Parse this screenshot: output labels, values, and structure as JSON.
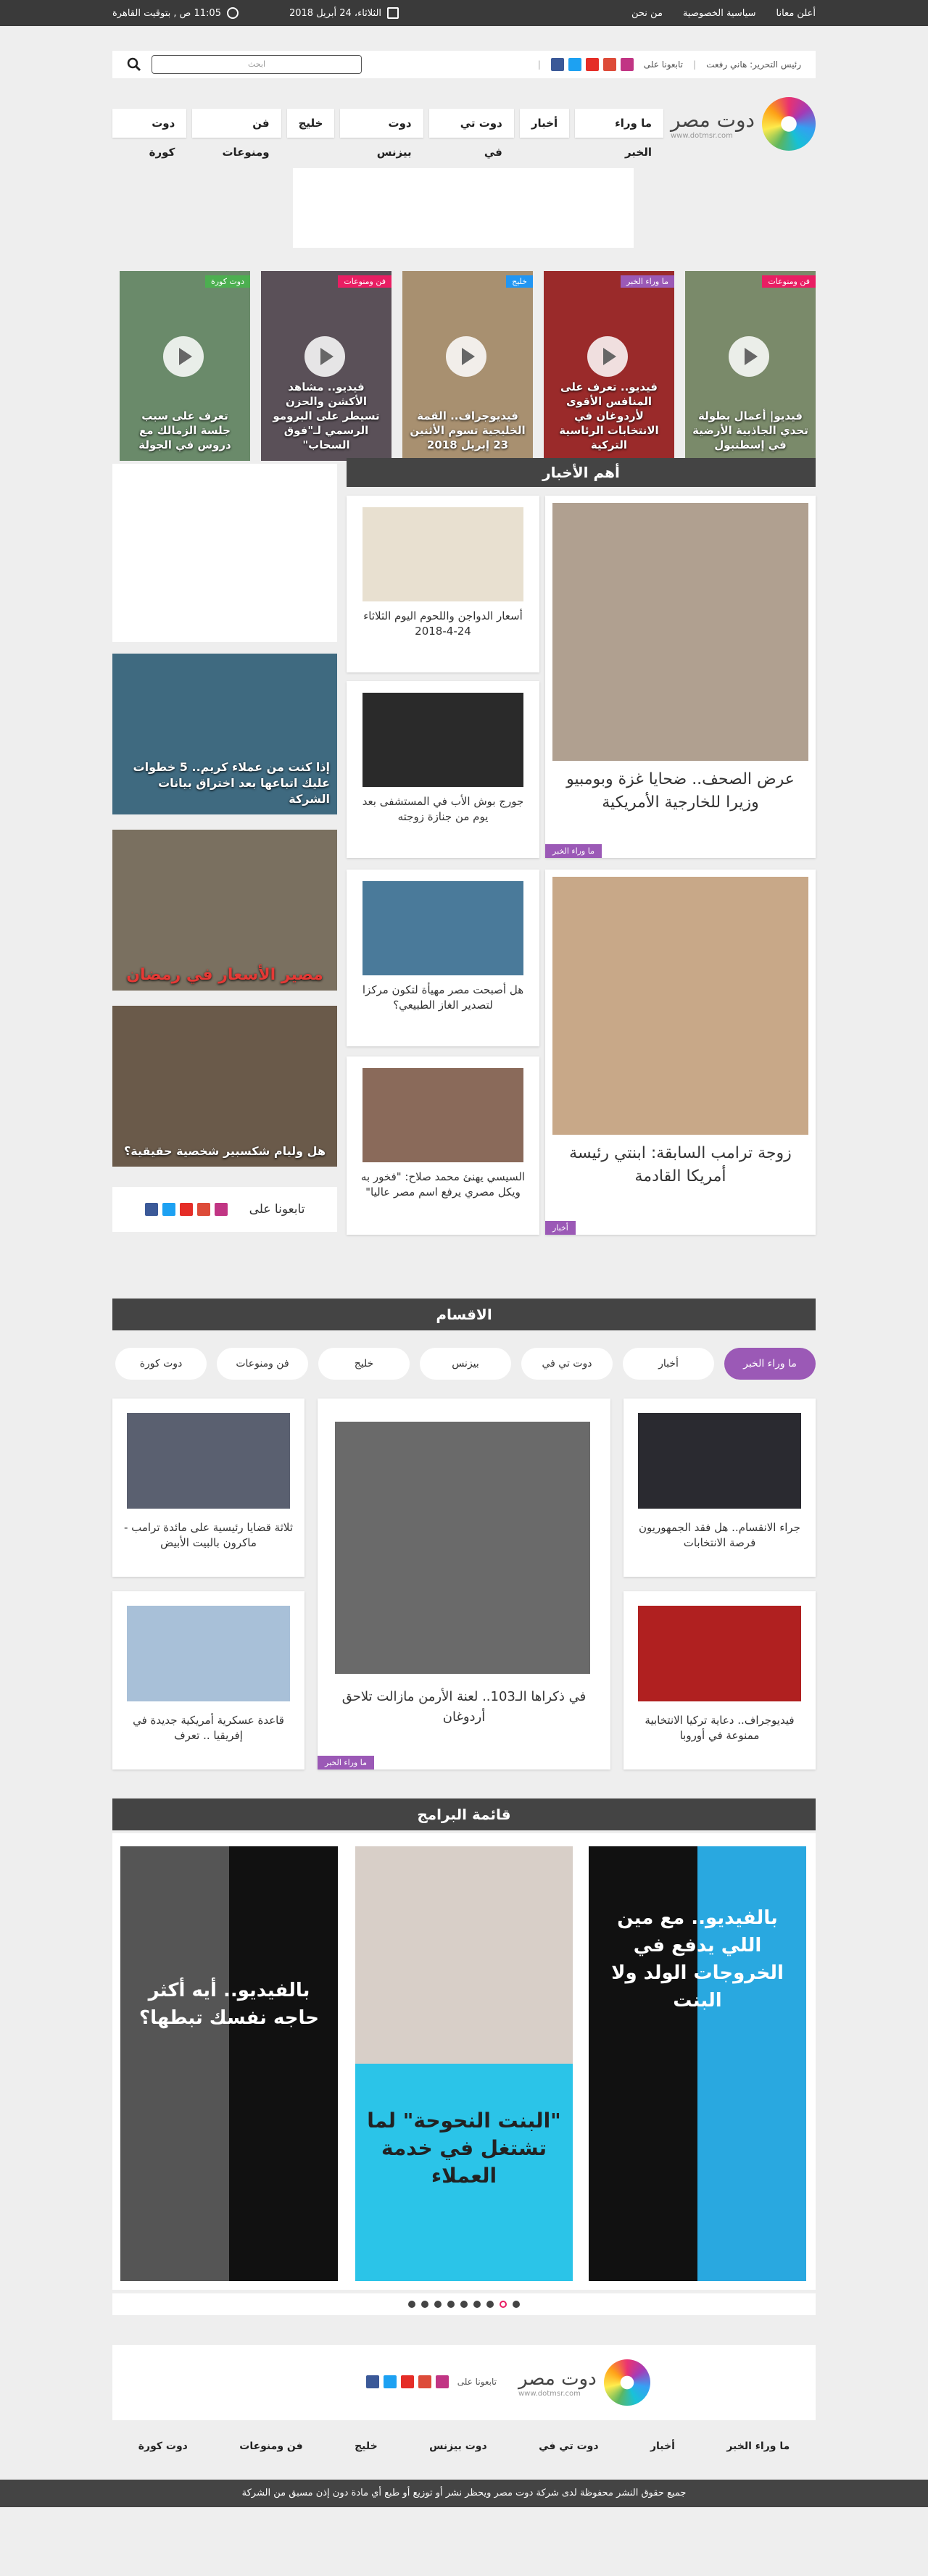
{
  "topbar": {
    "links": [
      "أعلن معانا",
      "سياسية الخصوصية",
      "من نحن"
    ],
    "date": "الثلاثاء، 24 أبريل 2018",
    "time": "11:05 ص , بتوقيت القاهرة"
  },
  "sitebar": {
    "editor": "رئيس التحرير: هاني رفعت",
    "follow": "تابعونا على",
    "search_placeholder": "ابحث"
  },
  "logo": {
    "title": "دوت مصر",
    "subtitle": "www.dotmsr.com"
  },
  "nav": [
    "ما وراء الخبر",
    "أخبار",
    "دوت تي في",
    "دوت بيزنس",
    "خليج",
    "فن ومنوعات",
    "دوت كورة"
  ],
  "videos": [
    {
      "cat": "فن ومنوعات",
      "title": "فيديو| أعمال بطولة تحدي الجاذبية الأرضية في إسطنبول"
    },
    {
      "cat": "ما وراء الخبر",
      "title": "فيديو.. تعرف على المنافس الأقوى لأردوغان في الانتخابات الرئاسية التركية"
    },
    {
      "cat": "خليج",
      "title": "فيديوجراف.. القمة الخليجية تسوم الأثنين 23 إبريل 2018"
    },
    {
      "cat": "فن ومنوعات",
      "title": "فيديو.. مشاهد الأكشن والحزن تسيطر على البرومو الرسمي لـ\"فوق السحاب\""
    },
    {
      "cat": "دوت كورة",
      "title": "تعرف على سبب جلسة الزمالك مع دروس في الجولة"
    }
  ],
  "top_news": {
    "heading": "أهم الأخبار",
    "main": [
      {
        "title": "عرض الصحف.. ضحايا غزة وبومبيو وزيرا للخارجية الأمريكية",
        "tag": "ما وراء الخبر"
      },
      {
        "title": "زوجة ترامب السابقة: ابنتي رئيسة أمريكا القادمة",
        "tag": "أخبار"
      }
    ],
    "small": [
      "أسعار الدواجن واللحوم اليوم الثلاثاء 24-4-2018",
      "جورج بوش الأب في المستشفى بعد يوم من جنازة زوجته",
      "هل أصبحت مصر مهيأة لتكون مركزا لتصدير الغاز الطبيعي؟",
      "السيسي يهنئ محمد صلاح: \"فخور به ويكل مصري يرفع اسم مصر عاليا\""
    ]
  },
  "side": {
    "items": [
      "إذا كنت من عملاء كريم.. 5 خطوات عليك اتباعها بعد اختراق بيانات الشركة",
      "مصير الأسعار في رمضان",
      "هل وليام شكسبير شخصية حقيقية؟"
    ],
    "follow": "تابعونا على"
  },
  "sections": {
    "heading": "الاقسام",
    "tabs": [
      "ما وراء الخبر",
      "أخبار",
      "دوت تي في",
      "بيزنس",
      "خليج",
      "فن ومنوعات",
      "دوت كورة"
    ],
    "cards": [
      "جراء الانقسام.. هل فقد الجمهوريون فرصة الانتخابات",
      "في ذكراها الـ103.. لعنة الأرمن مازالت تلاحق أردوغان",
      "ثلاثة قضايا رئيسية على مائدة ترامب - ماكرون بالبيت الأبيض",
      "فيديوجراف.. دعاية تركيا الانتخابية ممنوعة في أوروبا",
      "قاعدة عسكرية أمريكية جديدة في إفريقيا .. تعرف"
    ],
    "tag": "ما وراء الخبر"
  },
  "programs": {
    "heading": "قائمة البرامج",
    "items": [
      "بالفيديو.. مع مين اللي يدفع في الخروجات الولد ولا البنت",
      "\"البنت النحوحة\" لما تشتغل في خدمة العملاء",
      "بالفيديو.. أيه أكثر حاجه نفسك تبطها؟"
    ]
  },
  "footer": {
    "follow": "تابعونا على",
    "nav": [
      "ما وراء الخبر",
      "أخبار",
      "دوت تي في",
      "دوت بيزنس",
      "خليج",
      "فن ومنوعات",
      "دوت كورة"
    ],
    "copyright": "جميع حقوق النشر محفوظة لدى شركة دوت مصر ويحظر نشر أو توزيع أو طبع أي مادة دون إذن مسبق من الشركة"
  },
  "colors": {
    "accent": "#9b59b6",
    "dark": "#444444",
    "topbar": "#3a3a3a"
  },
  "icons": {
    "social": [
      "facebook-icon",
      "twitter-icon",
      "youtube-icon",
      "google-plus-icon",
      "instagram-icon"
    ]
  }
}
